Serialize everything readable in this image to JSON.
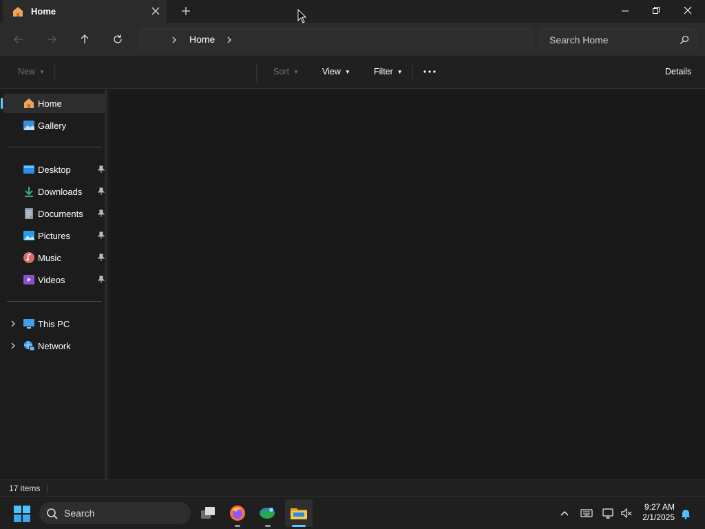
{
  "tab": {
    "title": "Home"
  },
  "address": {
    "location": "Home"
  },
  "search": {
    "placeholder": "Search Home"
  },
  "commandbar": {
    "new_label": "New",
    "sort_label": "Sort",
    "view_label": "View",
    "filter_label": "Filter",
    "details_label": "Details"
  },
  "sidebar": {
    "quick": [
      {
        "label": "Home",
        "icon": "home-icon"
      },
      {
        "label": "Gallery",
        "icon": "gallery-icon"
      }
    ],
    "pinned": [
      {
        "label": "Desktop",
        "icon": "desktop-icon"
      },
      {
        "label": "Downloads",
        "icon": "downloads-icon"
      },
      {
        "label": "Documents",
        "icon": "documents-icon"
      },
      {
        "label": "Pictures",
        "icon": "pictures-icon"
      },
      {
        "label": "Music",
        "icon": "music-icon"
      },
      {
        "label": "Videos",
        "icon": "videos-icon"
      }
    ],
    "locations": [
      {
        "label": "This PC",
        "icon": "this-pc-icon"
      },
      {
        "label": "Network",
        "icon": "network-icon"
      }
    ]
  },
  "status": {
    "item_count": "17 items"
  },
  "taskbar": {
    "search_label": "Search",
    "time": "9:27 AM",
    "date": "2/1/2025"
  },
  "colors": {
    "accent": "#60cdff",
    "folder": "#f3c23f",
    "background": "#191919"
  }
}
